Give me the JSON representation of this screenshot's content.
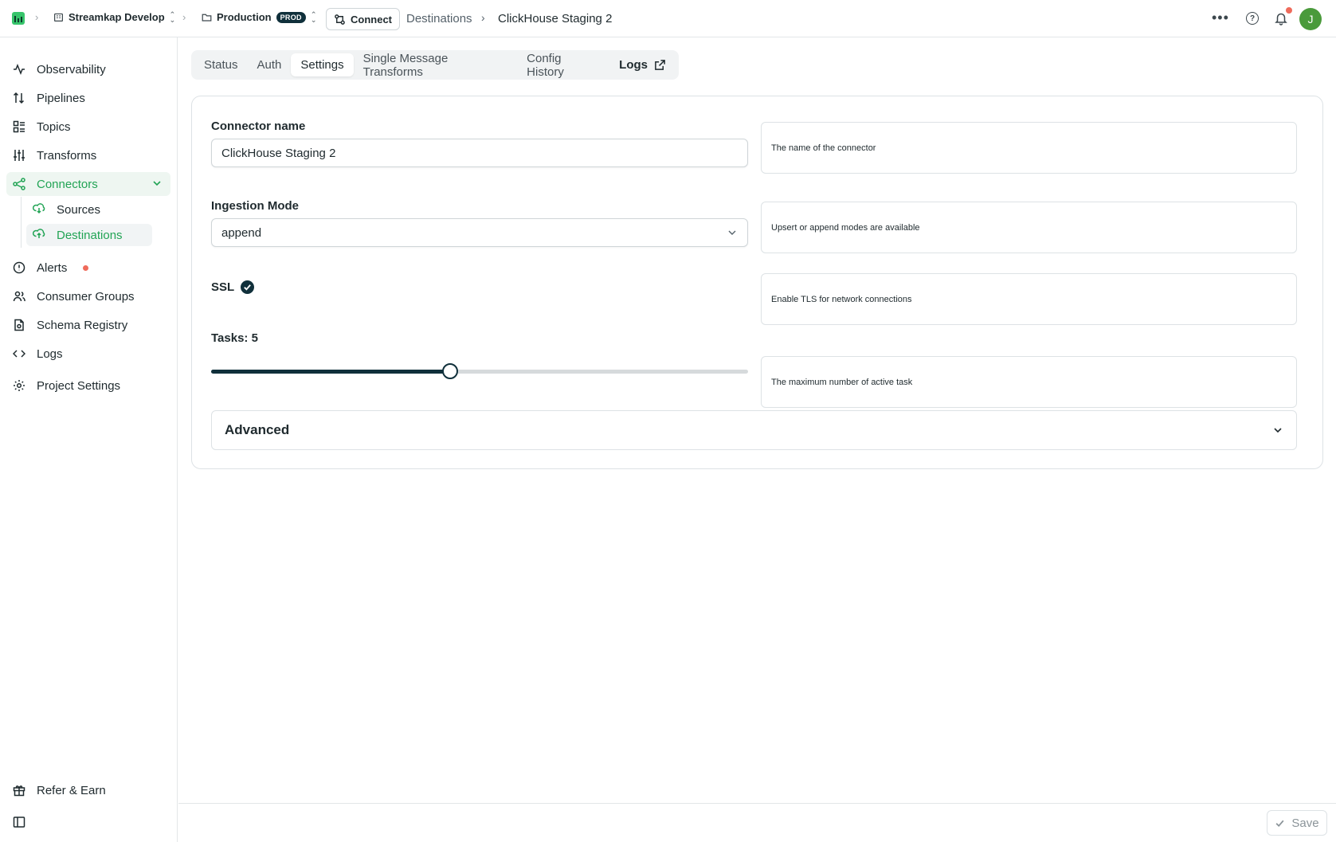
{
  "topbar": {
    "project_name": "Streamkap Develop",
    "environment_name": "Production",
    "environment_badge": "PROD",
    "connect_label": "Connect",
    "breadcrumb_section": "Destinations",
    "breadcrumb_current": "ClickHouse Staging 2",
    "avatar_initial": "J",
    "notification_dot_color": "#ef6b5b"
  },
  "sidebar": {
    "items": [
      {
        "label": "Observability",
        "icon": "activity-icon"
      },
      {
        "label": "Pipelines",
        "icon": "arrows-up-down-icon"
      },
      {
        "label": "Topics",
        "icon": "list-grid-icon"
      },
      {
        "label": "Transforms",
        "icon": "sliders-icon"
      },
      {
        "label": "Connectors",
        "icon": "share-nodes-icon",
        "active": true
      },
      {
        "label": "Alerts",
        "icon": "alert-circle-icon"
      },
      {
        "label": "Consumer Groups",
        "icon": "users-icon"
      },
      {
        "label": "Schema Registry",
        "icon": "file-schema-icon"
      },
      {
        "label": "Logs",
        "icon": "code-icon"
      },
      {
        "label": "Project Settings",
        "icon": "gear-icon"
      }
    ],
    "connector_subitems": [
      {
        "label": "Sources",
        "icon": "cloud-download-icon"
      },
      {
        "label": "Destinations",
        "icon": "cloud-upload-icon",
        "active": true
      }
    ],
    "footer_items": [
      {
        "label": "Refer & Earn",
        "icon": "gift-icon"
      }
    ],
    "accent_color": "#22a455"
  },
  "tabs": [
    {
      "label": "Status"
    },
    {
      "label": "Auth"
    },
    {
      "label": "Settings",
      "active": true
    },
    {
      "label": "Single Message Transforms"
    },
    {
      "label": "Config History"
    },
    {
      "label": "Logs",
      "external": true
    }
  ],
  "form": {
    "connector_name": {
      "label": "Connector name",
      "value": "ClickHouse Staging 2",
      "help": "The name of the connector"
    },
    "ingestion_mode": {
      "label": "Ingestion Mode",
      "value": "append",
      "help": "Upsert or append modes are available"
    },
    "ssl": {
      "label": "SSL",
      "checked": true,
      "help": "Enable TLS for network connections"
    },
    "tasks": {
      "label": "Tasks: 5",
      "value": 5,
      "fraction": 0.445,
      "help": "The maximum number of active task"
    },
    "advanced_label": "Advanced"
  },
  "footer": {
    "save_label": "Save"
  }
}
